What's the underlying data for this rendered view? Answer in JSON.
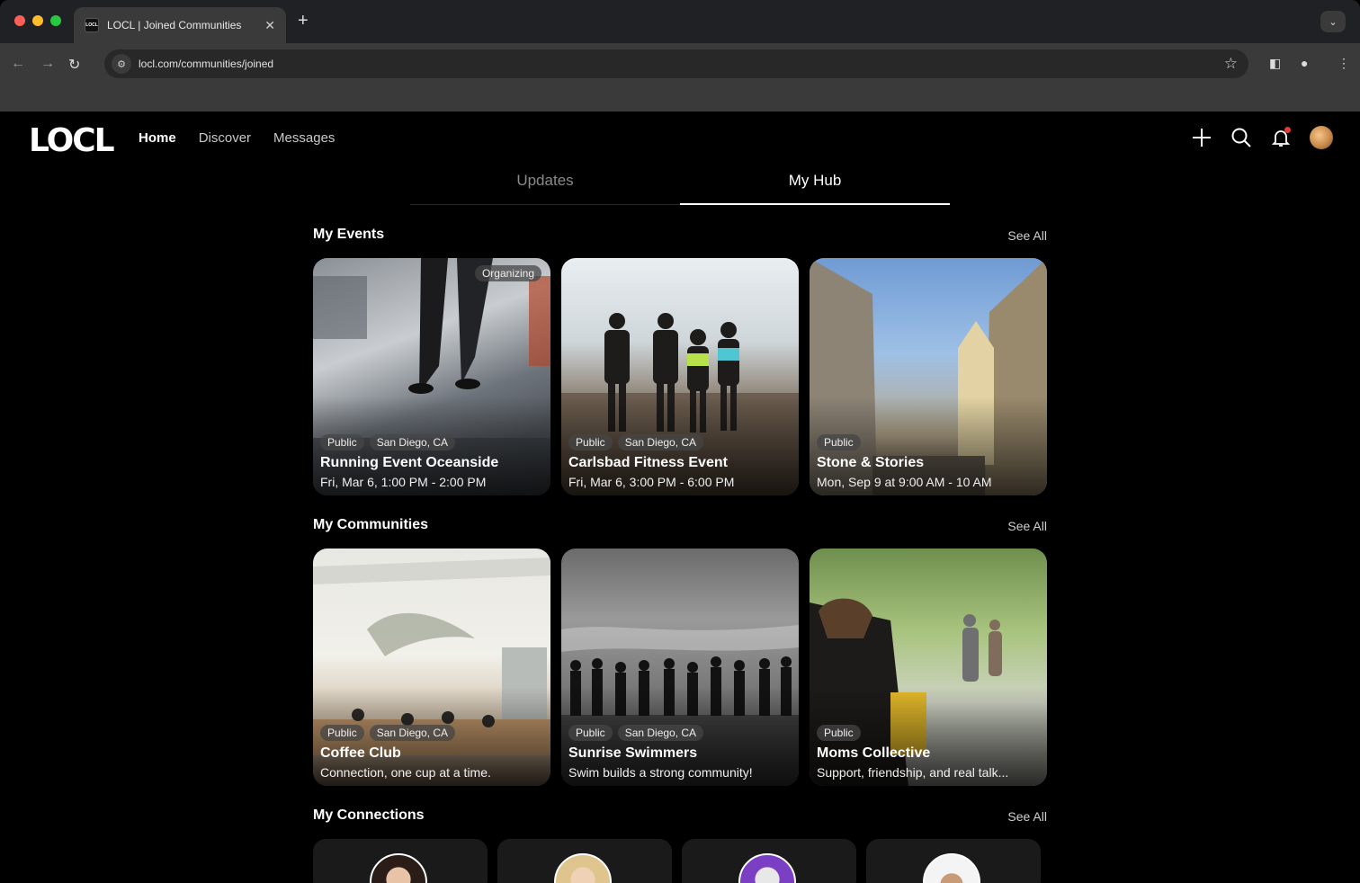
{
  "browser": {
    "tab_title": "LOCL | Joined Communities",
    "favicon_text": "LOCL",
    "url": "locl.com/communities/joined"
  },
  "header": {
    "logo": "LOCL",
    "nav": [
      {
        "label": "Home",
        "active": true
      },
      {
        "label": "Discover",
        "active": false
      },
      {
        "label": "Messages",
        "active": false
      }
    ],
    "icons": [
      "plus-icon",
      "search-icon",
      "bell-icon",
      "avatar"
    ]
  },
  "hub_tabs": {
    "updates": "Updates",
    "my_hub": "My Hub",
    "active": "my_hub"
  },
  "events": {
    "title": "My Events",
    "see_all": "See All",
    "items": [
      {
        "tag": "Organizing",
        "visibility": "Public",
        "location": "San Diego, CA",
        "title": "Running Event Oceanside",
        "subtitle": "Fri, Mar 6, 1:00 PM - 2:00 PM"
      },
      {
        "visibility": "Public",
        "location": "San Diego, CA",
        "title": "Carlsbad Fitness Event",
        "subtitle": "Fri, Mar 6, 3:00 PM - 6:00 PM"
      },
      {
        "visibility": "Public",
        "title": "Stone & Stories",
        "subtitle": "Mon, Sep 9 at 9:00 AM - 10 AM"
      }
    ]
  },
  "communities": {
    "title": "My Communities",
    "see_all": "See All",
    "items": [
      {
        "visibility": "Public",
        "location": "San Diego, CA",
        "title": "Coffee Club",
        "subtitle": "Connection, one cup at a time."
      },
      {
        "visibility": "Public",
        "location": "San Diego, CA",
        "title": "Sunrise Swimmers",
        "subtitle": "Swim builds a strong community!"
      },
      {
        "visibility": "Public",
        "title": "Moms Collective",
        "subtitle": "Support, friendship, and real talk..."
      }
    ]
  },
  "connections": {
    "title": "My Connections",
    "see_all": "See All"
  },
  "colors": {
    "background": "#000000",
    "notification": "#e53935"
  }
}
